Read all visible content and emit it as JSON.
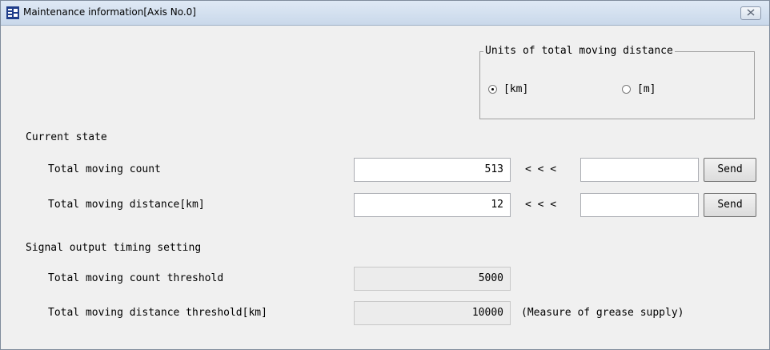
{
  "window": {
    "title": "Maintenance information[Axis No.0]",
    "close_icon": "close-x-icon",
    "app_icon": "app-logo-icon"
  },
  "units_group": {
    "legend": "Units of total moving distance",
    "options": [
      {
        "label": "[km]",
        "checked": true
      },
      {
        "label": "[m]",
        "checked": false
      }
    ]
  },
  "current_state": {
    "heading": "Current state",
    "rows": [
      {
        "label": "Total moving count",
        "value": "513",
        "arrows": "< < <",
        "input_value": "",
        "send_label": "Send"
      },
      {
        "label": "Total moving distance[km]",
        "value": "12",
        "arrows": "< < <",
        "input_value": "",
        "send_label": "Send"
      }
    ]
  },
  "signal_output": {
    "heading": "Signal output timing setting",
    "rows": [
      {
        "label": "Total moving count threshold",
        "value": "5000",
        "note": ""
      },
      {
        "label": "Total moving distance threshold[km]",
        "value": "10000",
        "note": "(Measure of grease supply)"
      }
    ]
  },
  "colors": {
    "window_bg": "#f0f0f0",
    "titlebar": "#c9d8ea",
    "icon_blue": "#1f3d8a"
  }
}
